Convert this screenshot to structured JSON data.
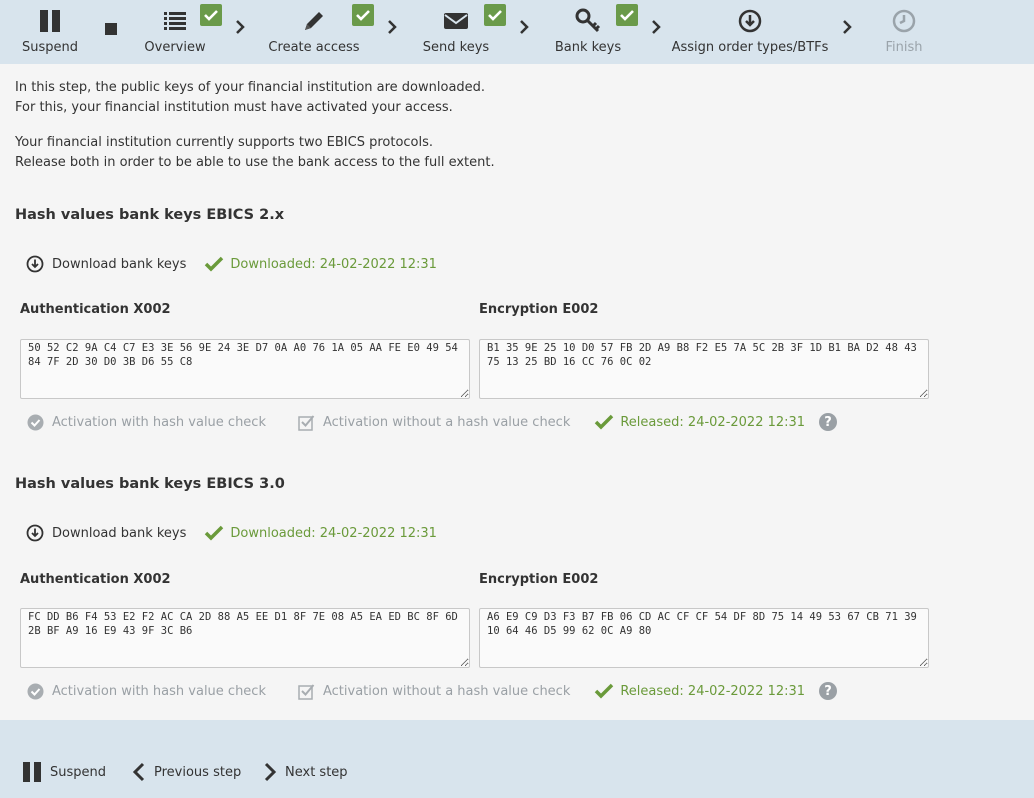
{
  "wizard": {
    "suspend_label": "Suspend",
    "steps": [
      {
        "label": "Overview",
        "done": true
      },
      {
        "label": "Create access",
        "done": true
      },
      {
        "label": "Send keys",
        "done": true
      },
      {
        "label": "Bank keys",
        "done": true
      },
      {
        "label": "Assign order types/BTFs",
        "done": false
      },
      {
        "label": "Finish",
        "done": false,
        "disabled": true
      }
    ]
  },
  "intro": {
    "line1": "In this step, the public keys of your financial institution are downloaded.",
    "line2": "For this, your financial institution must have activated your access.",
    "line3": "Your financial institution currently supports two EBICS protocols.",
    "line4": "Release both in order to be able to use the bank access to the full extent."
  },
  "sections": [
    {
      "title": "Hash values bank keys EBICS 2.x",
      "download_label": "Download bank keys",
      "downloaded_status": "Downloaded: 24-02-2022 12:31",
      "auth_label": "Authentication X002",
      "auth_hash": "50 52 C2 9A C4 C7 E3 3E 56 9E 24 3E D7 0A A0 76 1A 05 AA FE E0 49 54 84 7F 2D 30 D0 3B D6 55 C8",
      "enc_label": "Encryption E002",
      "enc_hash": "B1 35 9E 25 10 D0 57 FB 2D A9 B8 F2 E5 7A 5C 2B 3F 1D B1 BA D2 48 43 75 13 25 BD 16 CC 76 0C 02",
      "act_with": "Activation with hash value check",
      "act_without": "Activation without a hash value check",
      "released_status": "Released: 24-02-2022 12:31"
    },
    {
      "title": "Hash values bank keys EBICS 3.0",
      "download_label": "Download bank keys",
      "downloaded_status": "Downloaded: 24-02-2022 12:31",
      "auth_label": "Authentication X002",
      "auth_hash": "FC DD B6 F4 53 E2 F2 AC CA 2D 88 A5 EE D1 8F 7E 08 A5 EA ED BC 8F 6D 2B BF A9 16 E9 43 9F 3C B6",
      "enc_label": "Encryption E002",
      "enc_hash": "A6 E9 C9 D3 F3 B7 FB 06 CD AC CF CF 54 DF 8D 75 14 49 53 67 CB 71 39 10 64 46 D5 99 62 0C A9 80",
      "act_with": "Activation with hash value check",
      "act_without": "Activation without a hash value check",
      "released_status": "Released: 24-02-2022 12:31"
    }
  ],
  "footer": {
    "suspend_label": "Suspend",
    "previous_label": "Previous step",
    "next_label": "Next step"
  },
  "colors": {
    "bar_bg": "#d8e4ed",
    "success_green": "#6a9a3a",
    "muted_gray": "#9aa0a5"
  }
}
